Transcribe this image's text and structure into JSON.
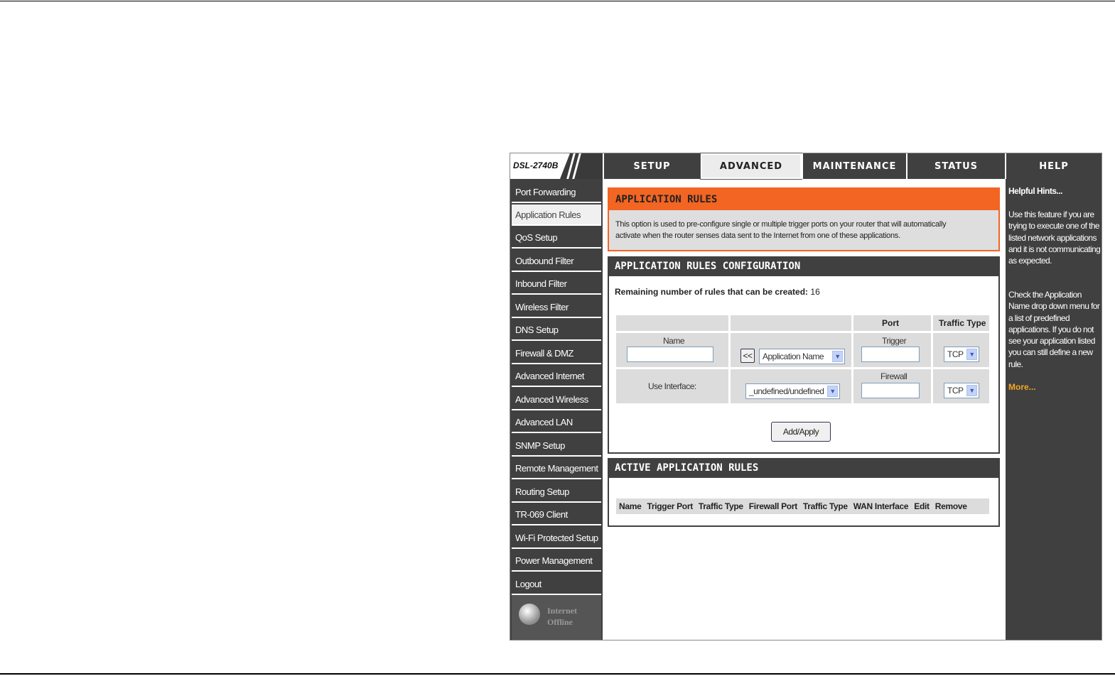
{
  "header": {
    "model": "DSL-2740B",
    "tabs": [
      "SETUP",
      "ADVANCED",
      "MAINTENANCE",
      "STATUS",
      "HELP"
    ],
    "active_tab": "ADVANCED"
  },
  "sidebar": {
    "items": [
      "Port Forwarding",
      "Application Rules",
      "QoS Setup",
      "Outbound Filter",
      "Inbound Filter",
      "Wireless Filter",
      "DNS Setup",
      "Firewall & DMZ",
      "Advanced Internet",
      "Advanced Wireless",
      "Advanced LAN",
      "SNMP Setup",
      "Remote Management",
      "Routing Setup",
      "TR-069 Client",
      "Wi-Fi Protected Setup",
      "Power Management",
      "Logout"
    ],
    "active_item": "Application Rules",
    "status_line1": "Internet",
    "status_line2": "Offline"
  },
  "intro": {
    "title": "APPLICATION RULES",
    "description_line1": "This option is used to pre-configure single or multiple trigger ports on your router that will automatically",
    "description_line2": "activate when the router senses data sent to the Internet from one of these applications."
  },
  "config": {
    "title": "APPLICATION RULES CONFIGURATION",
    "remaining_label": "Remaining number of rules that can be created:",
    "remaining_value": "16",
    "col_port": "Port",
    "col_traffic_type": "Traffic Type",
    "name_label": "Name",
    "copy_button": "<<",
    "app_name_select": "Application Name",
    "trigger_label": "Trigger",
    "trigger_protocol": "TCP",
    "use_interface_label": "Use Interface:",
    "interface_select": "_undefined/undefined",
    "firewall_label": "Firewall",
    "firewall_protocol": "TCP",
    "add_button": "Add/Apply"
  },
  "active_rules": {
    "title": "ACTIVE APPLICATION RULES",
    "columns": [
      "Name",
      "Trigger Port",
      "Traffic Type",
      "Firewall Port",
      "Traffic Type",
      "WAN Interface",
      "Edit",
      "Remove"
    ]
  },
  "help": {
    "title": "Helpful Hints...",
    "para1": "Use this feature if you are trying to execute one of the listed network applications and it is not communicating as expected.",
    "para2": "Check the Application Name drop down menu for a list of predefined applications. If you do not see your application listed you can still define a new rule.",
    "more": "More..."
  },
  "colors": {
    "accent": "#f26522",
    "dark": "#404040",
    "panel": "#dcdcdc",
    "link": "#f5a623"
  }
}
